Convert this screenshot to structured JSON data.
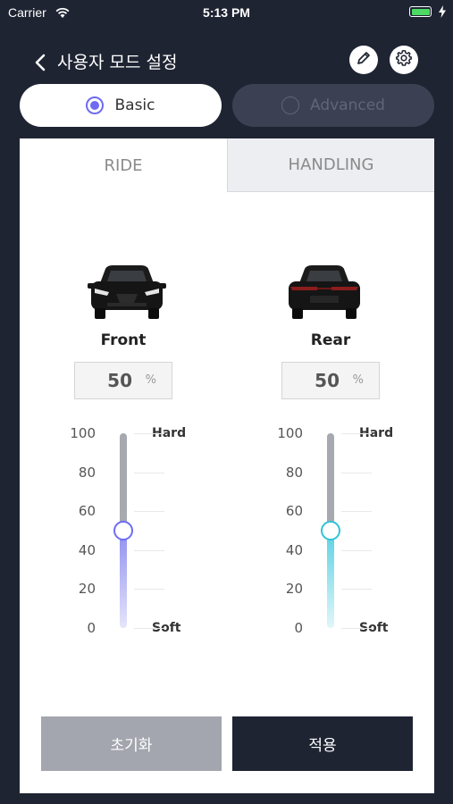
{
  "status_bar": {
    "carrier": "Carrier",
    "time": "5:13 PM"
  },
  "nav": {
    "title": "사용자 모드 설정"
  },
  "modes": {
    "basic": "Basic",
    "advanced": "Advanced",
    "selected": "basic"
  },
  "tabs": {
    "ride": "RIDE",
    "handling": "HANDLING",
    "active": "ride"
  },
  "front": {
    "label": "Front",
    "value": "50",
    "unit": "%"
  },
  "rear": {
    "label": "Rear",
    "value": "50",
    "unit": "%"
  },
  "scale": {
    "ticks": [
      "100",
      "80",
      "60",
      "40",
      "20",
      "0"
    ],
    "max": 100,
    "min": 0,
    "top_label": "Hard",
    "bottom_label": "Soft"
  },
  "buttons": {
    "reset": "초기화",
    "apply": "적용"
  },
  "colors": {
    "background": "#1f2433",
    "accent_front": "#6d6cf2",
    "accent_rear": "#32c3d6",
    "battery": "#4cd964"
  }
}
